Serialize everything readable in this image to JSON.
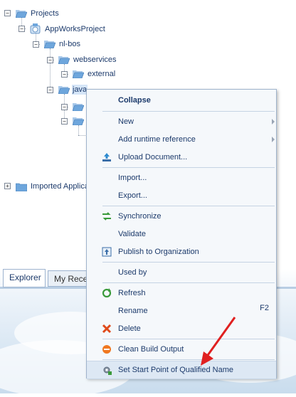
{
  "tree": {
    "root": "Projects",
    "project": "AppWorksProject",
    "folder_nlbos": "nl-bos",
    "folder_webservices": "webservices",
    "folder_external": "external",
    "folder_java": "java",
    "imported": "Imported Applica"
  },
  "tabs": [
    {
      "label": "Explorer"
    },
    {
      "label": "My Recen"
    }
  ],
  "menu": {
    "collapse": "Collapse",
    "new": "New",
    "add_runtime_reference": "Add runtime reference",
    "upload_document": "Upload Document...",
    "import": "Import...",
    "export": "Export...",
    "synchronize": "Synchronize",
    "validate": "Validate",
    "publish": "Publish to Organization",
    "used_by": "Used by",
    "refresh": "Refresh",
    "rename": "Rename",
    "rename_shortcut": "F2",
    "delete": "Delete",
    "clean_build": "Clean Build Output",
    "set_start_point": "Set Start Point of Qualified Name"
  },
  "annotation": {
    "color": "#e02020",
    "icon": "arrow-pointer"
  },
  "colors": {
    "text": "#1c3a6b",
    "folder": "#6ea6dc",
    "menu_bg": "#f5f8fb"
  }
}
